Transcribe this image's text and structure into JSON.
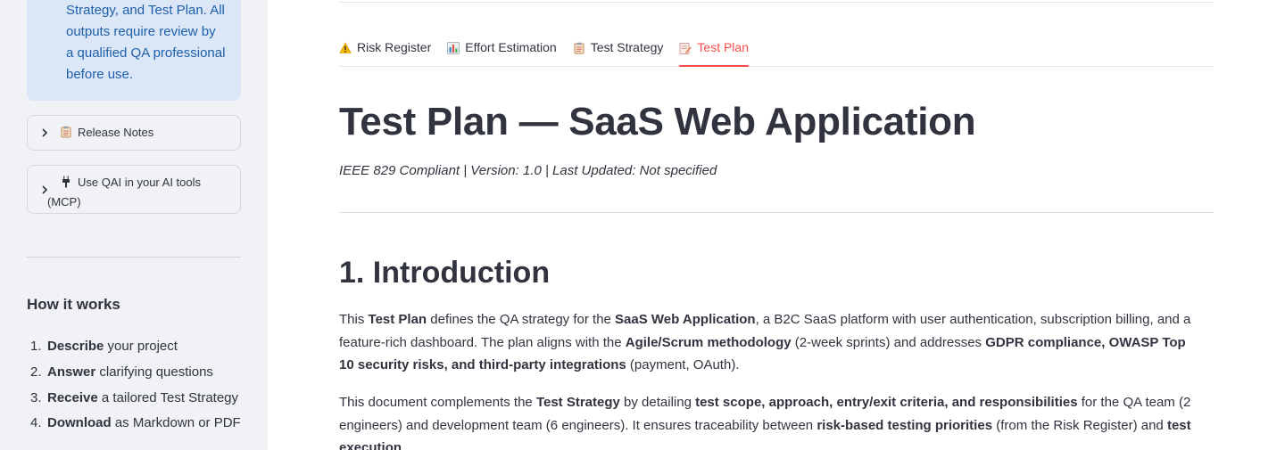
{
  "sidebar": {
    "info_lines": [
      "Strategy, and Test Plan. All",
      "outputs require review by",
      "a qualified QA professional",
      "before use."
    ],
    "expanders": [
      {
        "label": "Release Notes",
        "icon": "clipboard-icon"
      },
      {
        "label_line1": "Use QAI in your AI tools",
        "label_line2": "(MCP)",
        "icon": "plug-icon"
      }
    ],
    "how_heading": "How it works",
    "steps": [
      {
        "num": "1.",
        "bold": "Describe",
        "rest": " your project"
      },
      {
        "num": "2.",
        "bold": "Answer",
        "rest": " clarifying questions"
      },
      {
        "num": "3.",
        "bold": "Receive",
        "rest": " a tailored Test Strategy"
      },
      {
        "num": "4.",
        "bold": "Download",
        "rest": " as Markdown or PDF"
      }
    ]
  },
  "tabs": [
    {
      "label": "Risk Register",
      "icon": "warning-icon"
    },
    {
      "label": "Effort Estimation",
      "icon": "bar-chart-icon"
    },
    {
      "label": "Test Strategy",
      "icon": "clipboard-icon"
    },
    {
      "label": "Test Plan",
      "icon": "memo-icon",
      "active": true
    }
  ],
  "main": {
    "title": "Test Plan — SaaS Web Application",
    "subtitle": "IEEE 829 Compliant | Version: 1.0 | Last Updated: Not specified",
    "section_title": "1. Introduction",
    "p1": [
      "This ",
      "Test Plan",
      " defines the QA strategy for the ",
      "SaaS Web Application",
      ", a B2C SaaS platform with user authentication, subscription billing, and a feature-rich dashboard. The plan aligns with the ",
      "Agile/Scrum methodology",
      " (2-week sprints) and addresses ",
      "GDPR compliance, OWASP Top 10 security risks, and third-party integrations",
      " (payment, OAuth)."
    ],
    "p2": [
      "This document complements the ",
      "Test Strategy",
      " by detailing ",
      "test scope, approach, entry/exit criteria, and responsibilities",
      " for the QA team (2 engineers) and development team (6 engineers). It ensures traceability between ",
      "risk-based testing priorities",
      " (from the Risk Register) and ",
      "test execution",
      "."
    ]
  },
  "colors": {
    "accent": "#ff4b4b",
    "info_bg": "#dbe7f7",
    "info_text": "#1f5faa",
    "sidebar_bg": "#f0f2f6",
    "text": "#31333f"
  }
}
